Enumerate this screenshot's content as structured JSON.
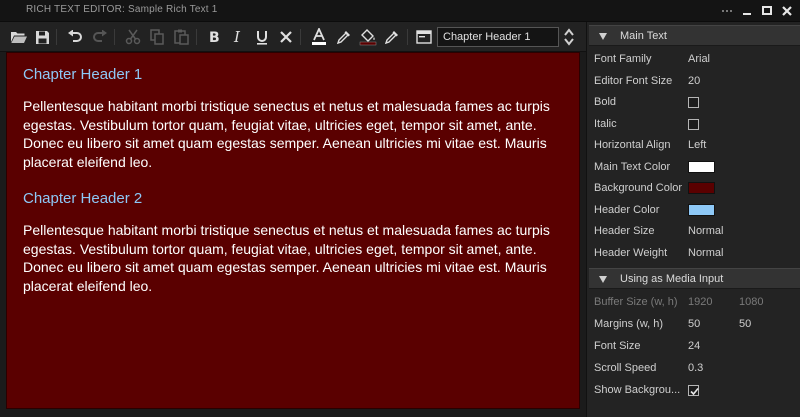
{
  "window": {
    "title": "RICH TEXT EDITOR: Sample Rich Text 1"
  },
  "toolbar": {
    "buttons": [
      {
        "name": "open-folder-icon"
      },
      {
        "name": "save-icon"
      },
      {
        "name": "undo-icon"
      },
      {
        "name": "redo-icon"
      },
      {
        "name": "cut-icon"
      },
      {
        "name": "copy-icon"
      },
      {
        "name": "paste-icon"
      },
      {
        "name": "bold-icon"
      },
      {
        "name": "italic-icon"
      },
      {
        "name": "underline-icon"
      },
      {
        "name": "clear-format-icon"
      },
      {
        "name": "text-color-icon"
      },
      {
        "name": "eyedropper-icon"
      },
      {
        "name": "fill-color-icon"
      },
      {
        "name": "pen-icon"
      },
      {
        "name": "paragraph-style-icon"
      }
    ],
    "style_select": {
      "value": "Chapter Header 1"
    }
  },
  "editor": {
    "blocks": [
      {
        "type": "header",
        "text": "Chapter Header 1"
      },
      {
        "type": "paragraph",
        "text": "Pellentesque habitant morbi tristique senectus et netus et malesuada fames ac turpis egestas. Vestibulum tortor quam, feugiat vitae, ultricies eget, tempor sit amet, ante. Donec eu libero sit amet quam egestas semper. Aenean ultricies mi vitae est. Mauris placerat eleifend leo."
      },
      {
        "type": "header",
        "text": "Chapter Header 2"
      },
      {
        "type": "paragraph",
        "text": "Pellentesque habitant morbi tristique senectus et netus et malesuada fames ac turpis egestas. Vestibulum tortor quam, feugiat vitae, ultricies eget, tempor sit amet, ante. Donec eu libero sit amet quam egestas semper. Aenean ultricies mi vitae est. Mauris placerat eleifend leo."
      }
    ],
    "colors": {
      "background": "#5a0000",
      "text": "#ffffff",
      "header": "#8ec8f6"
    }
  },
  "panel": {
    "main_text": {
      "title": "Main Text",
      "font_family": {
        "label": "Font Family",
        "value": "Arial"
      },
      "editor_font_size": {
        "label": "Editor Font Size",
        "value": "20"
      },
      "bold": {
        "label": "Bold",
        "checked": false
      },
      "italic": {
        "label": "Italic",
        "checked": false
      },
      "horizontal_align": {
        "label": "Horizontal Align",
        "value": "Left"
      },
      "main_text_color": {
        "label": "Main Text Color",
        "color": "#ffffff"
      },
      "background_color": {
        "label": "Background Color",
        "color": "#5a0000"
      },
      "header_color": {
        "label": "Header Color",
        "color": "#8ec8f6"
      },
      "header_size": {
        "label": "Header Size",
        "value": "Normal"
      },
      "header_weight": {
        "label": "Header Weight",
        "value": "Normal"
      }
    },
    "media_input": {
      "title": "Using as Media Input",
      "buffer_size": {
        "label": "Buffer Size (w, h)",
        "w": "1920",
        "h": "1080"
      },
      "margins": {
        "label": "Margins (w, h)",
        "w": "50",
        "h": "50"
      },
      "font_size": {
        "label": "Font Size",
        "value": "24"
      },
      "scroll_speed": {
        "label": "Scroll Speed",
        "value": "0.3"
      },
      "show_background": {
        "label": "Show Backgrou...",
        "checked": true
      }
    }
  }
}
